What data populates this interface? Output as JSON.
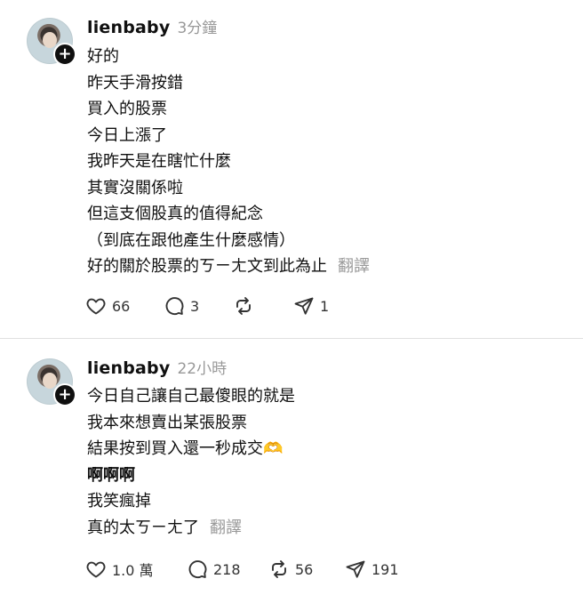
{
  "posts": [
    {
      "username": "lienbaby",
      "time": "3分鐘",
      "lines": [
        "好的",
        "昨天手滑按錯",
        "買入的股票",
        "今日上漲了",
        "我昨天是在瞎忙什麼",
        "其實沒關係啦",
        "但這支個股真的值得紀念",
        "（到底在跟他產生什麼感情）",
        "好的關於股票的ㄎㄧㄤ文到此為止"
      ],
      "translate": "翻譯",
      "likes": "66",
      "replies": "3",
      "reposts": "",
      "shares": "1"
    },
    {
      "username": "lienbaby",
      "time": "22小時",
      "lines": [
        "今日自己讓自己最傻眼的就是",
        "我本來想賣出某張股票",
        "結果按到買入還一秒成交",
        "啊啊啊",
        "我笑瘋掉",
        "真的太ㄎㄧㄤ了"
      ],
      "emoji": "🫶",
      "translate": "翻譯",
      "likes": "1.0 萬",
      "replies": "218",
      "reposts": "56",
      "shares": "191"
    }
  ],
  "icons": {
    "like": "heart-icon",
    "reply": "comment-icon",
    "repost": "repost-icon",
    "share": "send-icon",
    "follow": "plus-icon"
  },
  "colors": {
    "text": "#101010",
    "muted": "#999999",
    "divider": "#e0e0e0"
  }
}
